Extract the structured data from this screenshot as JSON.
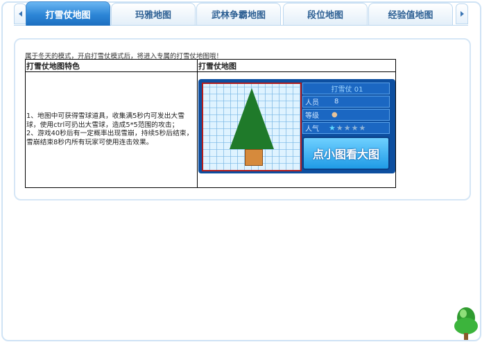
{
  "tabs": [
    {
      "label": "打雪仗地图",
      "active": true
    },
    {
      "label": "玛雅地图",
      "active": false
    },
    {
      "label": "武林争霸地图",
      "active": false
    },
    {
      "label": "段位地图",
      "active": false
    },
    {
      "label": "经验值地图",
      "active": false
    }
  ],
  "content": {
    "intro": "属于冬天的模式，开启打雪仗模式后，将进入专属的打雪仗地图哦！",
    "header_features": "打雪仗地图特色",
    "header_map": "打雪仗地图",
    "features_text": "1、地图中可获得雪球道具，收集满5秒内可发出大雪球，使用ctrl可扔出大雪球，造成5*5范围的攻击；\n2、游戏40秒后有一定概率出现雪崩，持续5秒后结束，雪崩结束8秒内所有玩家可使用连击效果。",
    "map_card": {
      "title": "打雪仗 01",
      "players_label": "人员",
      "players_value": "8",
      "level_label": "等级",
      "popularity_label": "人气",
      "popularity_stars": 1,
      "popularity_max": 5,
      "view_button": "点小图看大图"
    }
  }
}
